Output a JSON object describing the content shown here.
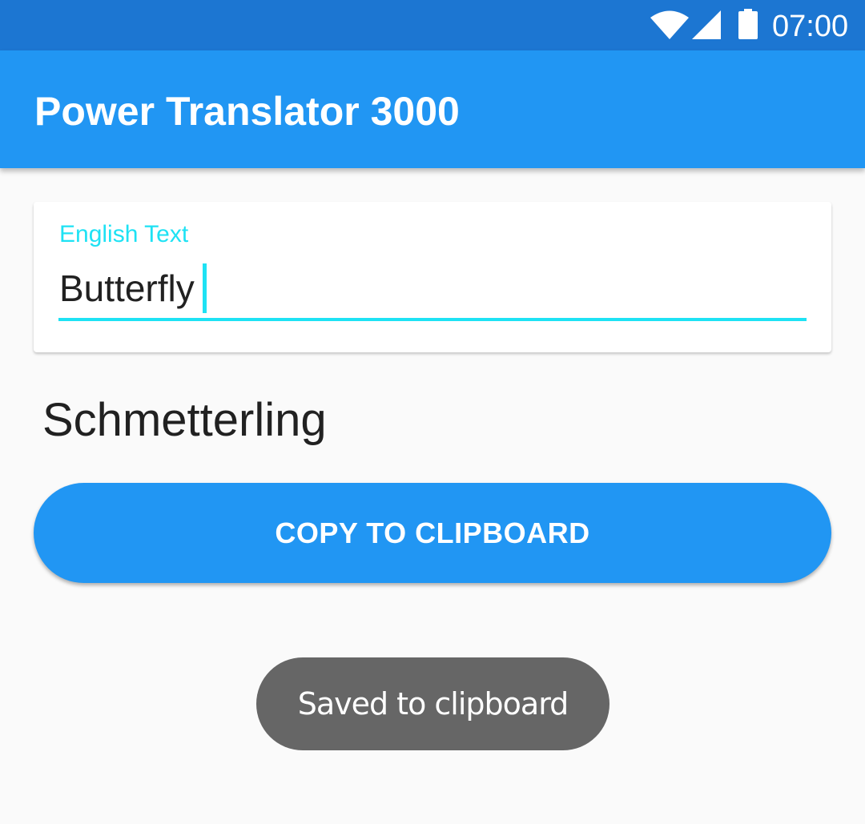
{
  "status_bar": {
    "time": "07:00",
    "icons": [
      "wifi-icon",
      "cell-signal-icon",
      "battery-icon"
    ],
    "background_color": "#1c76d2"
  },
  "app_bar": {
    "title": "Power Translator 3000",
    "background_color": "#2196f3"
  },
  "input_card": {
    "label": "English Text",
    "value": "Butterfly",
    "accent_color": "#1ee2f4"
  },
  "translation": {
    "text": "Schmetterling"
  },
  "copy_button": {
    "label": "COPY TO CLIPBOARD",
    "color": "#2196f3"
  },
  "toast": {
    "message": "Saved to clipboard",
    "color": "#666666"
  }
}
